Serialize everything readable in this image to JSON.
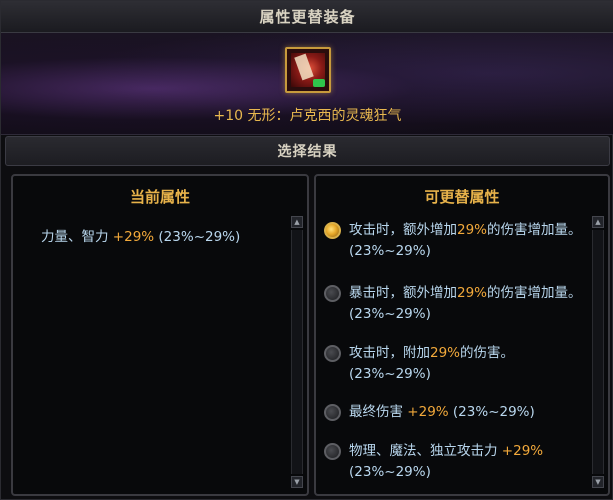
{
  "window": {
    "title": "属性更替装备"
  },
  "item": {
    "icon": "item-icon",
    "name": "+10 无形：卢克西的灵魂狂气"
  },
  "section": {
    "label": "选择结果"
  },
  "current": {
    "header": "当前属性",
    "attr": {
      "prefix": "力量、智力 ",
      "value": "+29%",
      "range": " (23%~29%)"
    }
  },
  "replaceable": {
    "header": "可更替属性",
    "options": [
      {
        "selected": true,
        "pre": "攻击时，额外增加",
        "value": "29%",
        "post": "的伤害增加量。(23%~29%)"
      },
      {
        "selected": false,
        "pre": "暴击时，额外增加",
        "value": "29%",
        "post": "的伤害增加量。(23%~29%)"
      },
      {
        "selected": false,
        "pre": "攻击时，附加",
        "value": "29%",
        "post": "的伤害。(23%~29%)"
      },
      {
        "selected": false,
        "pre": "最终伤害 ",
        "value": "+29%",
        "post": " (23%~29%)"
      },
      {
        "selected": false,
        "pre": "物理、魔法、独立攻击力 ",
        "value": "+29%",
        "post": " (23%~29%)"
      }
    ]
  },
  "colors": {
    "gold": "#e8b84f",
    "orange": "#f2a93b",
    "text_blue": "#b9d7ee"
  }
}
